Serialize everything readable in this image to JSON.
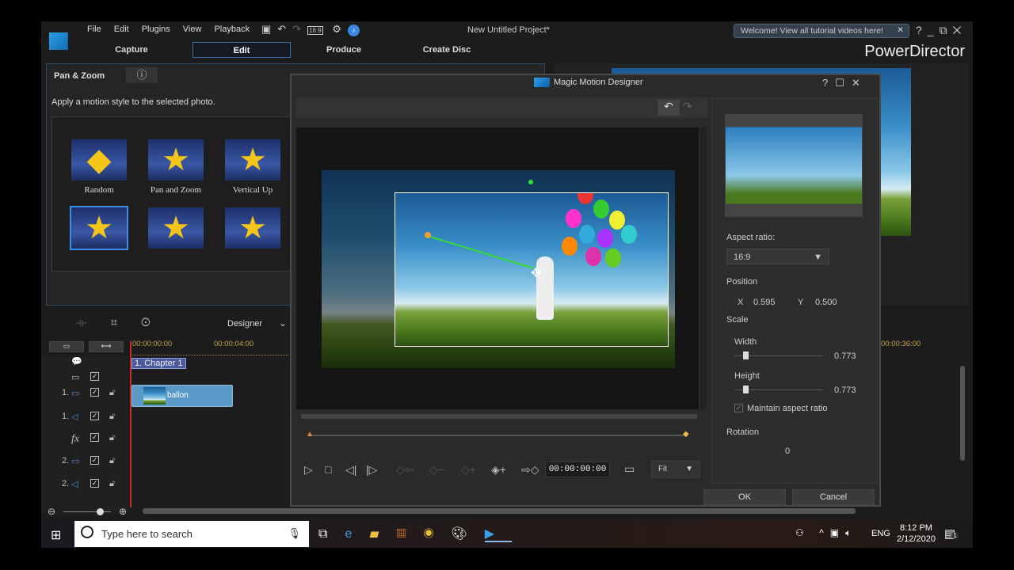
{
  "app": {
    "menu": [
      "File",
      "Edit",
      "Plugins",
      "View",
      "Playback"
    ],
    "project_title": "New Untitled Project*",
    "tutorial_tip": "Welcome! View all tutorial videos here!",
    "brand": "PowerDirector",
    "ratio": "16:9",
    "tabs": [
      {
        "label": "Capture"
      },
      {
        "label": "Edit",
        "active": true
      },
      {
        "label": "Produce"
      },
      {
        "label": "Create Disc"
      }
    ]
  },
  "panel": {
    "title": "Pan & Zoom",
    "description": "Apply a motion style to the selected photo.",
    "styles": [
      {
        "label": "Random"
      },
      {
        "label": "Pan and Zoom"
      },
      {
        "label": "Vertical Up"
      },
      {
        "label": "",
        "selected": true
      },
      {
        "label": ""
      },
      {
        "label": ""
      }
    ]
  },
  "timeline": {
    "designer_label": "Designer",
    "times": [
      "00:00:00:00",
      "00:00:04:00",
      "00:00:36:00"
    ],
    "chapter": "1. Chapter 1",
    "clip": "ballon",
    "tracks": [
      {
        "num": "1.",
        "type": "video"
      },
      {
        "num": "1.",
        "type": "audio"
      },
      {
        "num": "",
        "type": "fx",
        "label": "fx"
      },
      {
        "num": "2.",
        "type": "video"
      },
      {
        "num": "2.",
        "type": "audio"
      }
    ]
  },
  "dialog": {
    "title": "Magic Motion Designer",
    "timecode": "00:00:00:00",
    "zoom": "Fit",
    "aspect_label": "Aspect ratio:",
    "aspect_value": "16:9",
    "position_label": "Position",
    "x_label": "X",
    "x_value": "0.595",
    "y_label": "Y",
    "y_value": "0.500",
    "scale_label": "Scale",
    "width_label": "Width",
    "width_value": "0.773",
    "height_label": "Height",
    "height_value": "0.773",
    "maintain_label": "Maintain aspect ratio",
    "maintain_checked": true,
    "rotation_label": "Rotation",
    "rotation_value": "0",
    "ok": "OK",
    "cancel": "Cancel"
  },
  "taskbar": {
    "search_placeholder": "Type here to search",
    "language": "ENG",
    "time": "8:12 PM",
    "date": "2/12/2020",
    "notifications": "1"
  }
}
